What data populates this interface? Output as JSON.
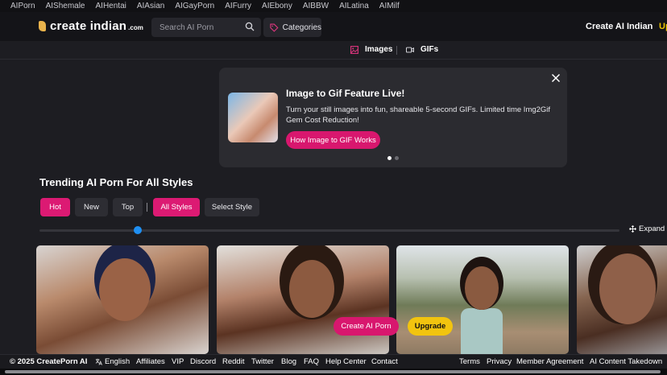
{
  "top_nav": [
    "AIPorn",
    "AIShemale",
    "AIHentai",
    "AIAsian",
    "AIGayPorn",
    "AIFurry",
    "AIEbony",
    "AIBBW",
    "AILatina",
    "AIMilf"
  ],
  "header": {
    "logo_name": "create indian",
    "logo_tld": ".com",
    "search_placeholder": "Search AI Porn",
    "categories_label": "Categories",
    "create_label": "Create AI Indian",
    "upgrade_partial": "Up"
  },
  "media_tabs": {
    "images": "Images",
    "gifs": "GIFs"
  },
  "banner": {
    "title": "Image to Gif Feature Live!",
    "description": "Turn your still images into fun, shareable 5-second GIFs. Limited time Img2Gif Gem Cost Reduction!",
    "cta": "How Image to GIF Works",
    "slide_count": 2,
    "active_slide": 1
  },
  "section": {
    "title": "Trending AI Porn For All Styles"
  },
  "filters": {
    "sort": [
      "Hot",
      "New",
      "Top"
    ],
    "active_sort": "Hot",
    "all_styles": "All Styles",
    "select_style": "Select Style"
  },
  "slider": {
    "position": 0.17
  },
  "expand_label": "Expand G",
  "cards": {
    "create_cta": "Create AI Porn",
    "upgrade_cta": "Upgrade"
  },
  "footer": {
    "copyright": "© 2025 CreatePorn AI",
    "language": "English",
    "links": [
      "Affiliates",
      "VIP",
      "Discord",
      "Reddit",
      "Twitter",
      "Blog",
      "FAQ",
      "Help Center",
      "Contact"
    ],
    "right_links": [
      "Terms",
      "Privacy",
      "Member Agreement",
      "AI Content Takedown"
    ]
  },
  "colors": {
    "accent": "#dc1a73",
    "upgrade": "#f2c40f",
    "bg": "#1d1d22",
    "slider": "#1f8ff2"
  }
}
